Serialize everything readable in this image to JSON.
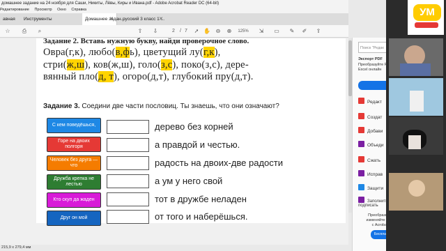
{
  "window": {
    "title": "домашнее задание на 24 ноября для Саши, Никиты, Лёвы, Киры и Ивана.pdf - Adobe Acrobat Reader DC (64-bit)",
    "menu": [
      "Редактирование",
      "Просмотр",
      "Окно",
      "Справка"
    ]
  },
  "tabs": {
    "home": "авная",
    "tools": "Инструменты",
    "doc1": "Домашнее задан...",
    "doc2": "русский 3 класс 1 ..."
  },
  "toolbar": {
    "page_current": "2",
    "page_sep": "/",
    "page_total": "7",
    "zoom": "125%"
  },
  "document": {
    "prev_task_partial": "Задание 2. Вставь нужную букву, найди проверочное слово.",
    "lines": [
      [
        {
          "t": "Овра(г,к),  любо(",
          "h": false
        },
        {
          "t": "в,ф",
          "h": true
        },
        {
          "t": "ь),  цветущий  лу(",
          "h": false
        },
        {
          "t": "г,к",
          "h": true
        },
        {
          "t": "),",
          "h": false
        }
      ],
      [
        {
          "t": "стри(",
          "h": false
        },
        {
          "t": "ж,ш",
          "h": true
        },
        {
          "t": "),  ков(ж,ш),  голо(",
          "h": false
        },
        {
          "t": "з,с",
          "h": true
        },
        {
          "t": "),  поко(з,с),  дере-",
          "h": false
        }
      ],
      [
        {
          "t": "вянный  пло(",
          "h": false
        },
        {
          "t": "д, т",
          "h": true
        },
        {
          "t": "), огоро(д,т), глубокий пру(д,т).",
          "h": false
        }
      ]
    ],
    "task3_label": "Задание 3.",
    "task3_text": " Соедини две части пословиц. Ты знаешь, что они означают?",
    "proverb_starts": [
      {
        "text": "С кем поведёшься,",
        "color": "#1e88e5"
      },
      {
        "text": "Горе на двоих полгоря",
        "color": "#e53935"
      },
      {
        "text": "Человек без друга — что",
        "color": "#f57c00"
      },
      {
        "text": "Дружба крепка не лестью",
        "color": "#2e7d32"
      },
      {
        "text": "Кто скуп да жаден",
        "color": "#d81bd8"
      },
      {
        "text": "Друг он мой",
        "color": "#1565c0"
      }
    ],
    "proverb_ends": [
      "дерево без корней",
      "а правдой и честью.",
      "радость на двоих-две радости",
      "а ум у него свой",
      "тот в дружбе неладен",
      "от того и наберёшься."
    ]
  },
  "status_bar": {
    "page_size": "215,9 x 279,4 мм"
  },
  "right_pane": {
    "search_placeholder": "Поиск \"Редак",
    "export_title": "Экспорт PDF",
    "export_sub1": "Преобразуйте PDF в",
    "export_sub2": "Excel онлайн",
    "items": [
      {
        "label": "Редакт",
        "color": "#e53935"
      },
      {
        "label": "Создат",
        "color": "#e53935"
      },
      {
        "label": "Добави",
        "color": "#e53935"
      },
      {
        "label": "Объеди",
        "color": "#7b1fa2"
      },
      {
        "label": "Сжать",
        "color": "#e53935"
      },
      {
        "label": "Исправ",
        "color": "#7b1fa2"
      },
      {
        "label": "Защити",
        "color": "#1e88e5"
      }
    ],
    "fill_sign": "Заполнить и подписать",
    "promo_1": "Преобразовывайте и изменяйте файлы PDF",
    "promo_2": "с Acrobat Pro DC",
    "promo_button": "Бесплатная пробная версия"
  },
  "logo_text": "УМ"
}
